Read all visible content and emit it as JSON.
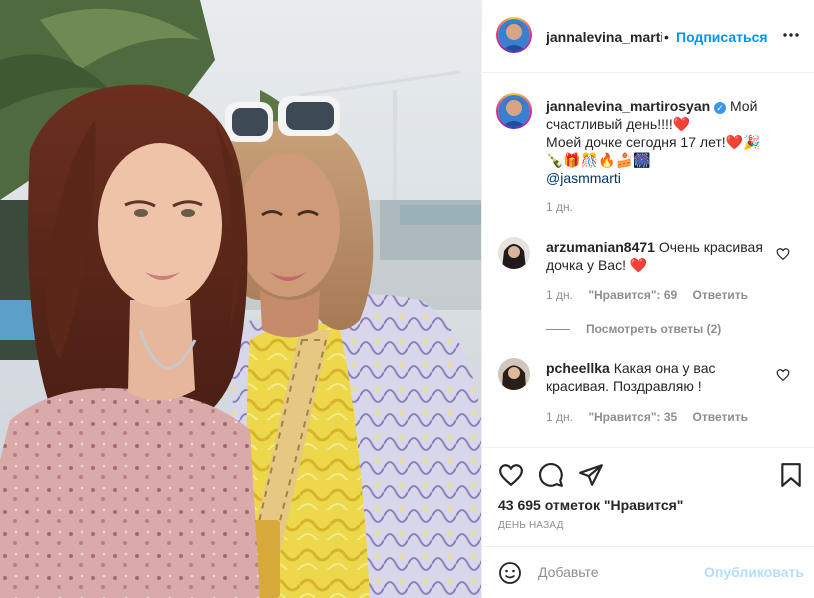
{
  "header": {
    "username": "jannalevina_martirosyan",
    "separator": "•",
    "follow_label": "Подписаться",
    "more_label": "•••"
  },
  "caption": {
    "username": "jannalevina_martirosyan",
    "verified_mark": "✓",
    "line1": "Мой счастливый день!!!!",
    "heart": "❤️",
    "line2": "Моей дочке сегодня 17 лет!",
    "emojis_line2": "❤️🎉",
    "emojis_line3": "🍾🎁🎊🔥🍰🎆",
    "mention": "@jasmmarti",
    "time": "1 дн."
  },
  "comments": [
    {
      "username": "arzumanian8471",
      "text": "Очень красивая дочка у Вас!",
      "emoji": "❤️",
      "time": "1 дн.",
      "likes": "\"Нравится\": 69",
      "reply_label": "Ответить"
    },
    {
      "username": "pcheellka",
      "text": "Какая она у вас красивая. Поздравляю !",
      "emoji": "",
      "time": "1 дн.",
      "likes": "\"Нравится\": 35",
      "reply_label": "Ответить"
    }
  ],
  "replies_label": "Посмотреть ответы (2)",
  "likes_count": "43 695 отметок \"Нравится\"",
  "post_date": "ДЕНЬ НАЗАД",
  "add_comment": {
    "placeholder": "Добавьте",
    "publish_label": "Опубликовать"
  },
  "icons": {
    "more": "more-dots-icon",
    "like": "heart-icon",
    "comment": "comment-bubble-icon",
    "share": "share-paper-plane-icon",
    "save": "bookmark-icon",
    "emoji": "smiley-icon"
  },
  "colors": {
    "link_blue": "#0095f6",
    "publish_disabled": "#b2dffc",
    "verified": "#3897f0",
    "mention": "#00376b",
    "muted": "#8e8e8e"
  }
}
